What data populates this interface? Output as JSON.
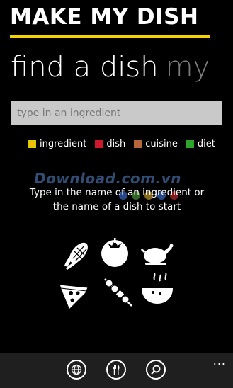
{
  "app": {
    "title": "MAKE MY DISH"
  },
  "pivot": {
    "active": "find a dish",
    "next": "my"
  },
  "search": {
    "placeholder": "type in an ingredient",
    "value": ""
  },
  "legend": [
    {
      "label": "ingredient",
      "color": "#e8c400"
    },
    {
      "label": "dish",
      "color": "#cc1a2a"
    },
    {
      "label": "cuisine",
      "color": "#b5653a"
    },
    {
      "label": "diet",
      "color": "#2aa52a"
    }
  ],
  "watermark": {
    "text": "Download.com.vn"
  },
  "hint": {
    "text": "Type in the name of an ingredient or the name of a dish to start"
  },
  "icons": [
    "corn-icon",
    "tomato-icon",
    "chicken-icon",
    "pizza-slice-icon",
    "kebab-icon",
    "soup-bowl-icon"
  ],
  "appbar": {
    "buttons": [
      "globe-icon",
      "cutlery-icon",
      "search-icon"
    ],
    "more": "..."
  }
}
